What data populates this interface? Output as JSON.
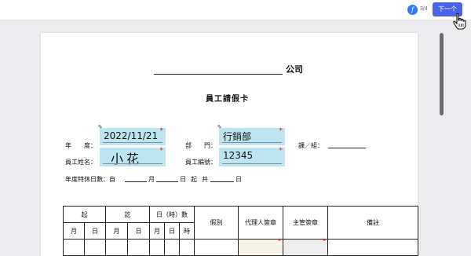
{
  "toolbar": {
    "avatar_letter": "f",
    "page_counter": "3/4",
    "next_label": "下一个"
  },
  "document": {
    "company_suffix": "公司",
    "title": "員工請假卡",
    "row1": {
      "year_label": "年　　度：",
      "dept_label": "部　　門：",
      "section_label": "課／組：",
      "year_value": "2022/11/21",
      "dept_value": "行銷部"
    },
    "row2": {
      "name_label": "員工姓名：",
      "id_label": "員工編號：",
      "name_value": "小花",
      "id_value": "12345"
    },
    "row3": {
      "annual_label": "年度特休日數：自",
      "month": "月",
      "day_start": "日",
      "from": "起",
      "total": "共",
      "day_end": "日"
    },
    "table": {
      "from": "起",
      "to": "訖",
      "duration": "日（時）數",
      "leave_type": "假別",
      "agent_sign": "代理人簽章",
      "manager_sign": "主管簽章",
      "remarks": "備註",
      "month": "月",
      "day": "日",
      "hour": "時",
      "required_mark": "*"
    },
    "required_mark": "*"
  }
}
